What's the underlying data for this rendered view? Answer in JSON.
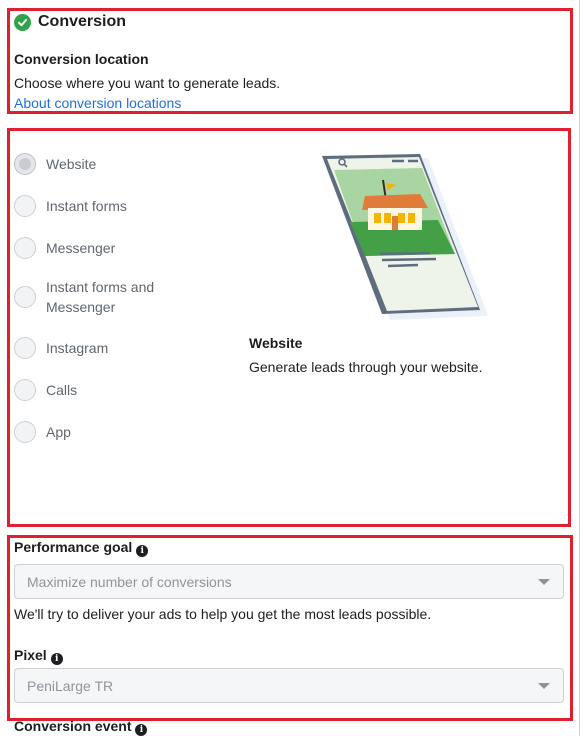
{
  "section": {
    "title": "Conversion",
    "location_label": "Conversion location",
    "location_desc": "Choose where you want to generate leads.",
    "about_link": "About conversion locations"
  },
  "options": [
    {
      "label": "Website",
      "selected": true
    },
    {
      "label": "Instant forms",
      "selected": false
    },
    {
      "label": "Messenger",
      "selected": false
    },
    {
      "label": "Instant forms and Messenger",
      "selected": false
    },
    {
      "label": "Instagram",
      "selected": false
    },
    {
      "label": "Calls",
      "selected": false
    },
    {
      "label": "App",
      "selected": false
    }
  ],
  "preview": {
    "title": "Website",
    "desc": "Generate leads through your website."
  },
  "performance": {
    "label": "Performance goal",
    "value": "Maximize number of conversions",
    "help": "We'll try to deliver your ads to help you get the most leads possible."
  },
  "pixel": {
    "label": "Pixel",
    "value": "PeniLarge TR"
  },
  "conversion_event": {
    "label": "Conversion event"
  },
  "colors": {
    "highlight_border": "#e0202e",
    "success": "#31a24c",
    "link": "#216fdb"
  }
}
